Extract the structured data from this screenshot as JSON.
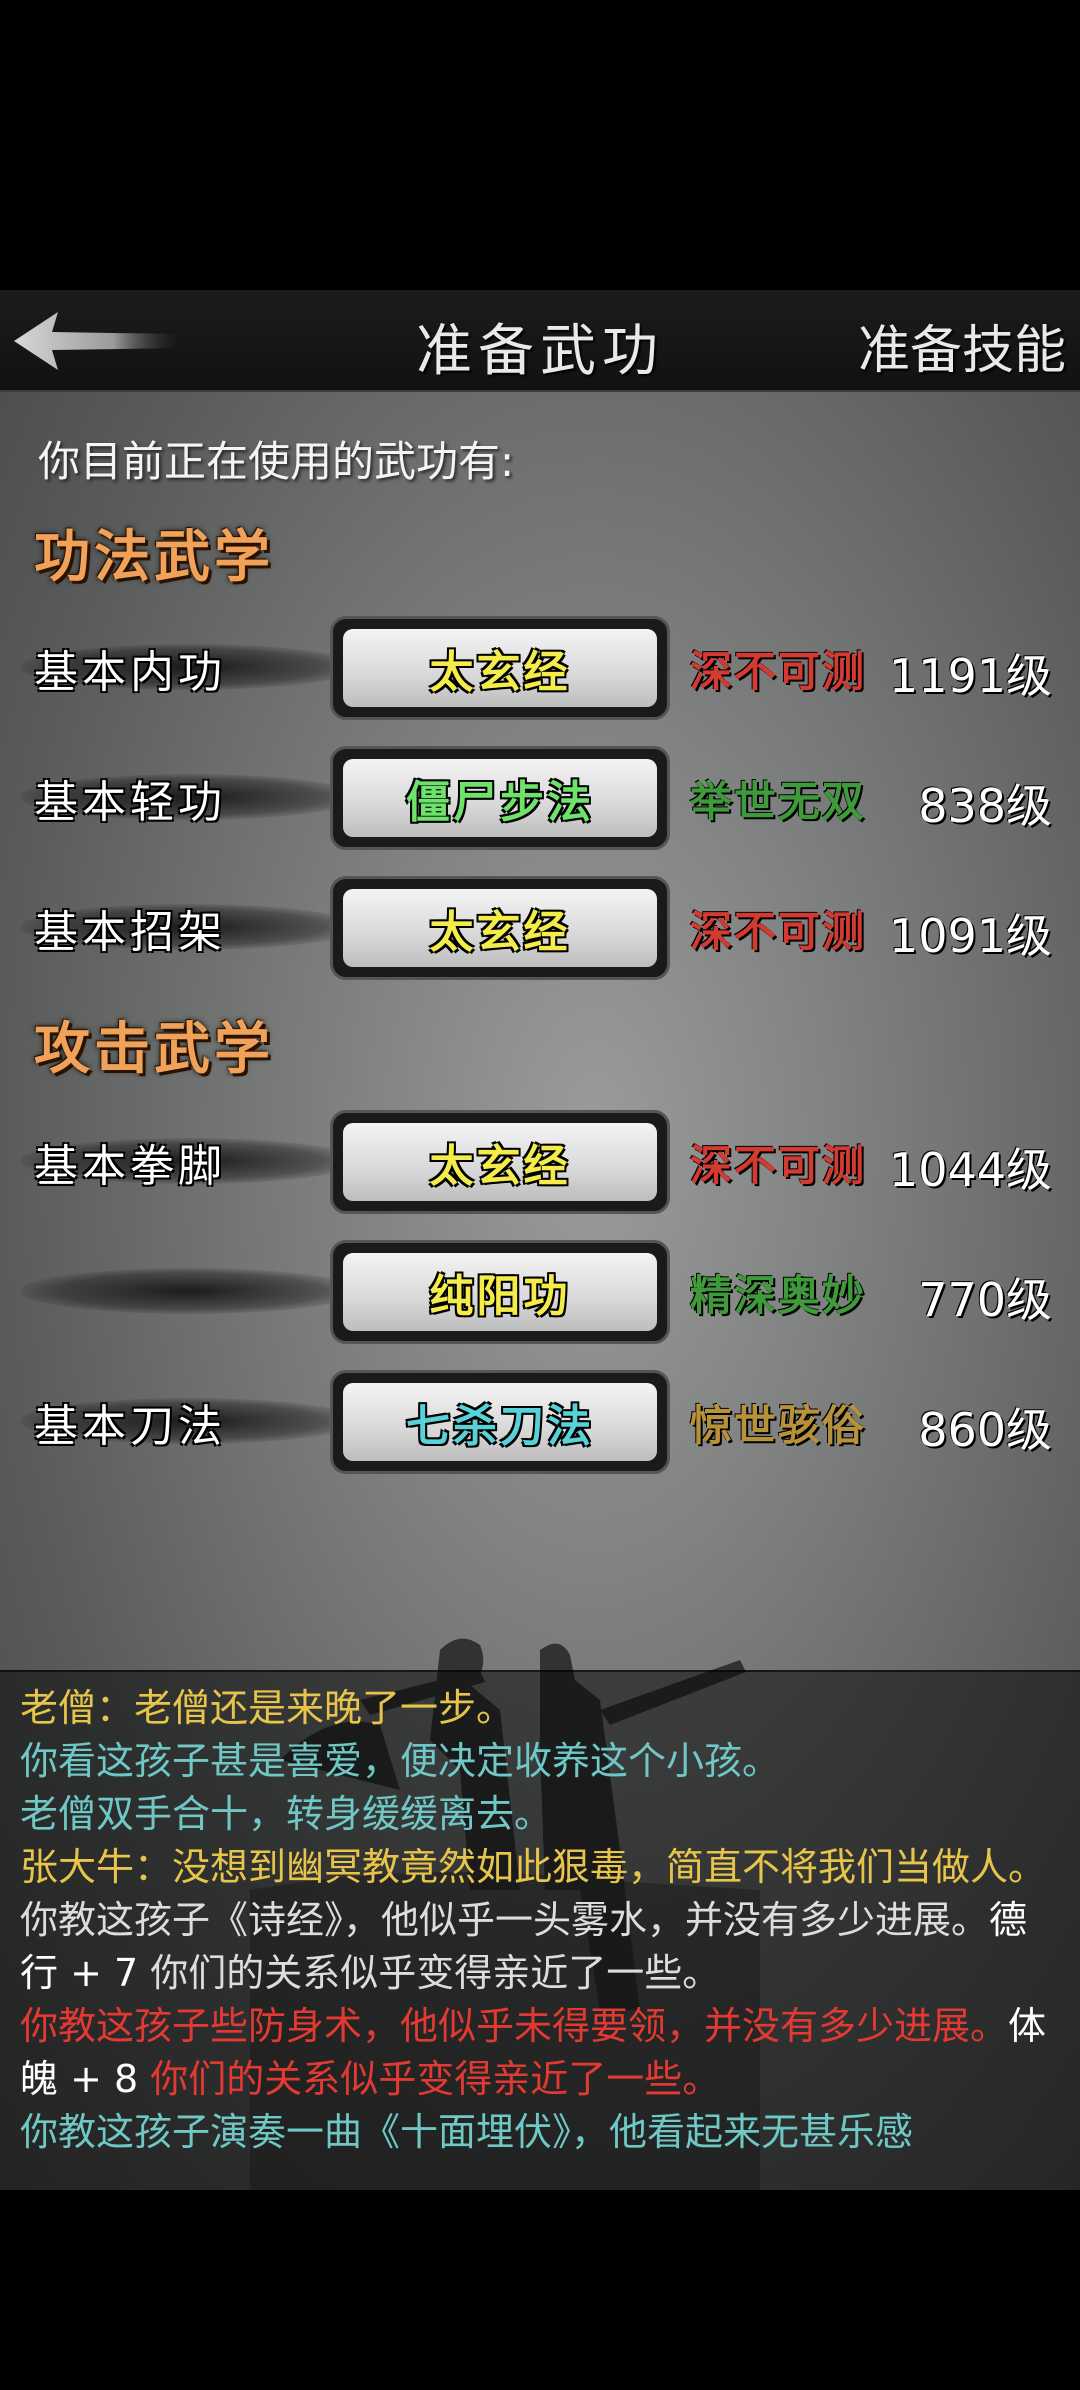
{
  "header": {
    "title": "准备武功",
    "right_button": "准备技能"
  },
  "intro": "你目前正在使用的武功有:",
  "sections": {
    "internal": "功法武学",
    "attack": "攻击武学"
  },
  "rows": [
    {
      "label": "基本内功",
      "skill": "太玄经",
      "skill_color": "#f3ec4a",
      "rank": "深不可测",
      "rank_color": "#d23a32",
      "level": "1191级"
    },
    {
      "label": "基本轻功",
      "skill": "僵尸步法",
      "skill_color": "#6ee26a",
      "rank": "举世无双",
      "rank_color": "#3e9a3a",
      "level": "838级"
    },
    {
      "label": "基本招架",
      "skill": "太玄经",
      "skill_color": "#f3ec4a",
      "rank": "深不可测",
      "rank_color": "#d23a32",
      "level": "1091级"
    },
    {
      "label": "基本拳脚",
      "skill": "太玄经",
      "skill_color": "#f3ec4a",
      "rank": "深不可测",
      "rank_color": "#d23a32",
      "level": "1044级"
    },
    {
      "label": "",
      "skill": "纯阳功",
      "skill_color": "#f3ec4a",
      "rank": "精深奥妙",
      "rank_color": "#3e9a3a",
      "level": "770级"
    },
    {
      "label": "基本刀法",
      "skill": "七杀刀法",
      "skill_color": "#58d2d8",
      "rank": "惊世骇俗",
      "rank_color": "#b8923a",
      "level": "860级"
    }
  ],
  "log": [
    {
      "color": "#e7c44a",
      "parts": [
        {
          "text": "老僧：老僧还是来晚了一步。",
          "color": "#e7c44a"
        }
      ]
    },
    {
      "color": "#6fc7c6",
      "parts": [
        {
          "text": "你看这孩子甚是喜爱，便决定收养这个小孩。",
          "color": "#6fc7c6"
        }
      ]
    },
    {
      "color": "#6fc7c6",
      "parts": [
        {
          "text": "老僧双手合十，转身缓缓离去。",
          "color": "#6fc7c6"
        }
      ]
    },
    {
      "color": "#e7c44a",
      "parts": [
        {
          "text": "张大牛：没想到幽冥教竟然如此狠毒，简直不将我们当做人。",
          "color": "#e7c44a"
        }
      ]
    },
    {
      "color": "#dddddd",
      "parts": [
        {
          "text": "你教这孩子《诗经》，他似乎一头雾水，并没有多少进展。",
          "color": "#dddddd"
        },
        {
          "text": "德行 + 7 ",
          "color": "#ffffff"
        },
        {
          "text": "你们的关系似乎变得亲近了一些。",
          "color": "#dddddd"
        }
      ]
    },
    {
      "color": "#e23a32",
      "parts": [
        {
          "text": "你教这孩子些防身术，他似乎未得要领，并没有多少进展。",
          "color": "#e23a32"
        },
        {
          "text": "体魄 + 8 ",
          "color": "#ffffff"
        },
        {
          "text": "你们的关系似乎变得亲近了一些。",
          "color": "#e23a32"
        }
      ]
    },
    {
      "color": "#6fc7c6",
      "parts": [
        {
          "text": "你教这孩子演奏一曲《十面埋伏》，他看起来无甚乐感",
          "color": "#6fc7c6"
        }
      ]
    }
  ]
}
